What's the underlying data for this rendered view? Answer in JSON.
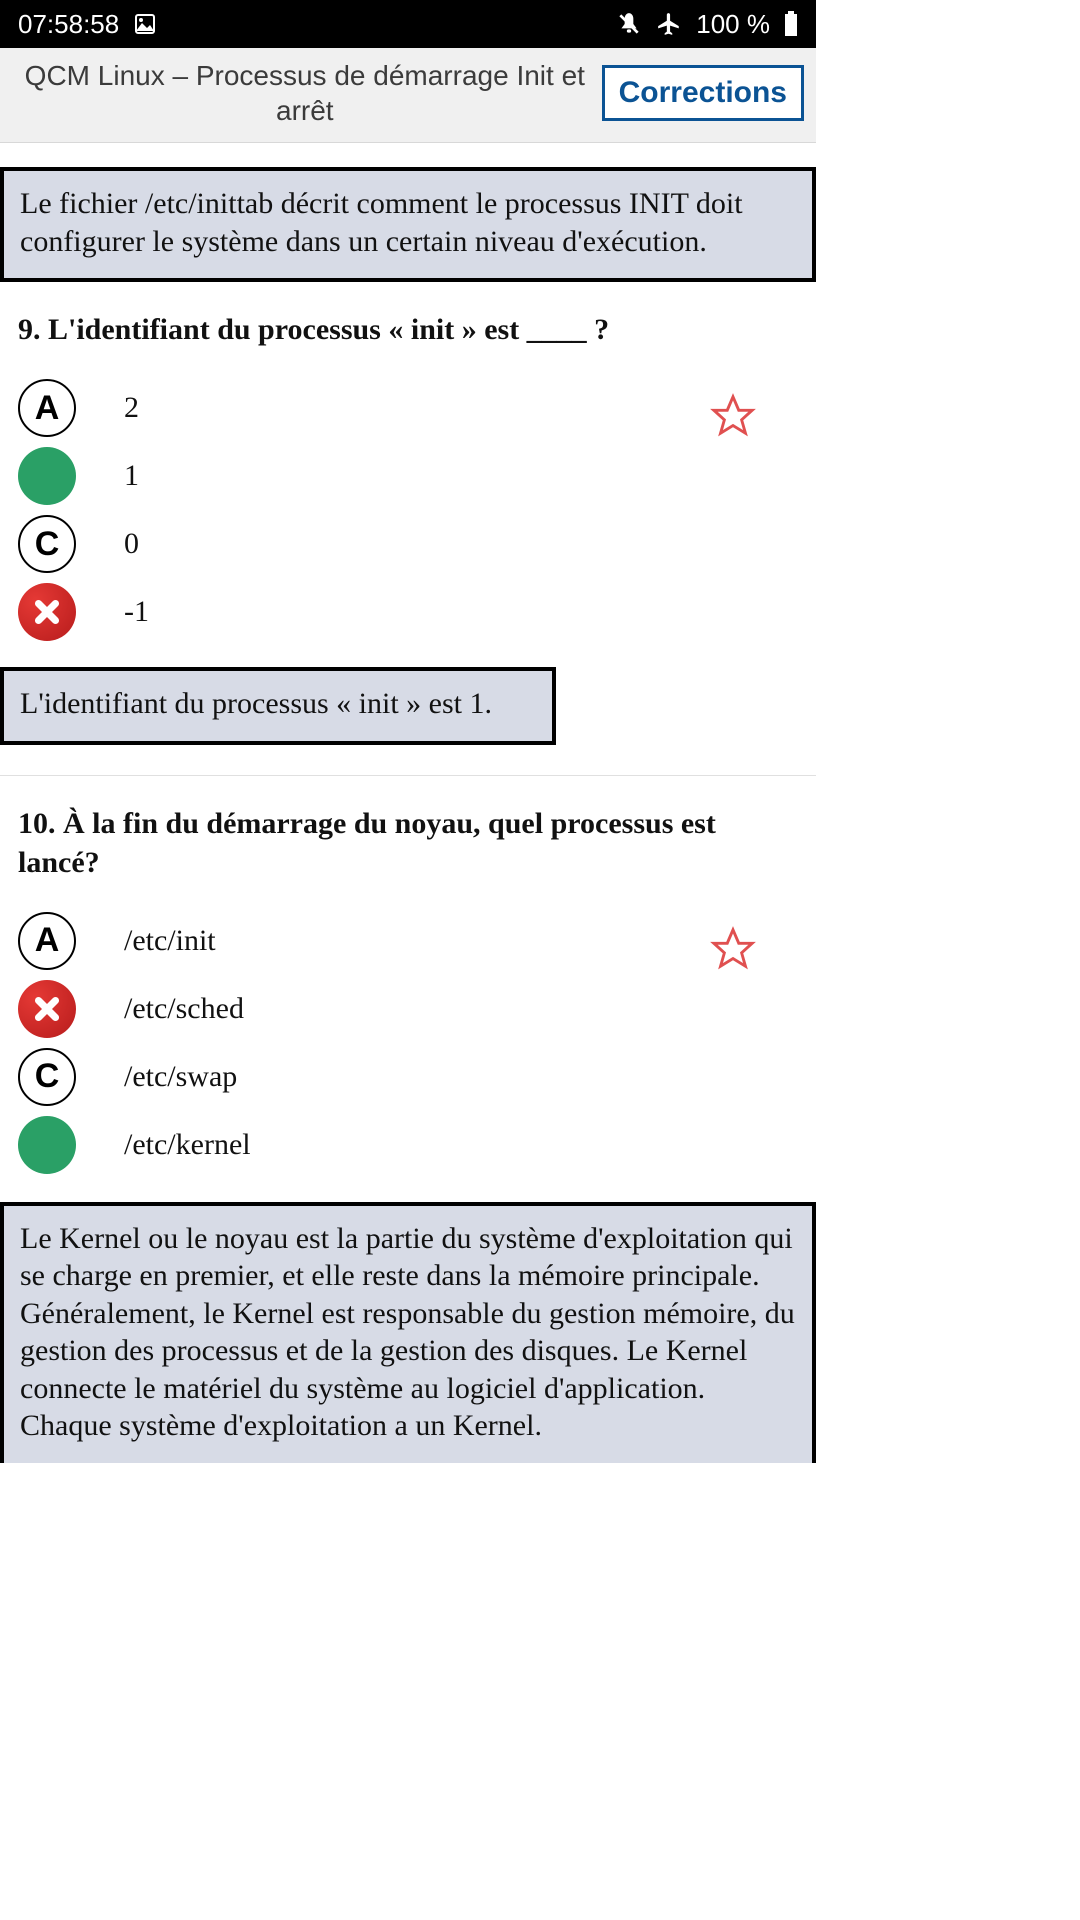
{
  "statusbar": {
    "time": "07:58:58",
    "battery_text": "100 %"
  },
  "appbar": {
    "title": "QCM Linux – Processus de démarrage Init et arrêt",
    "corrections_label": "Corrections"
  },
  "top_info": "Le fichier /etc/inittab décrit comment le processus INIT doit configurer le système dans un certain niveau d'exécution.",
  "q9": {
    "title": "9. L'identifiant du processus « init » est ____ ?",
    "options": [
      {
        "marker": "A",
        "state": "letter",
        "text": "2"
      },
      {
        "marker": "",
        "state": "correct",
        "text": "1"
      },
      {
        "marker": "C",
        "state": "letter",
        "text": "0"
      },
      {
        "marker": "",
        "state": "wrong",
        "text": "-1"
      }
    ],
    "explanation": "L'identifiant du processus « init » est 1."
  },
  "q10": {
    "title": "10. À la fin du démarrage du noyau, quel processus est lancé?",
    "options": [
      {
        "marker": "A",
        "state": "letter",
        "text": "/etc/init"
      },
      {
        "marker": "",
        "state": "wrong",
        "text": "/etc/sched"
      },
      {
        "marker": "C",
        "state": "letter",
        "text": "/etc/swap"
      },
      {
        "marker": "",
        "state": "correct",
        "text": "/etc/kernel"
      }
    ],
    "explanation": "Le Kernel ou le noyau est la partie du système d'exploitation qui se charge en premier, et elle reste dans la mémoire principale. Généralement, le Kernel est responsable du gestion mémoire, du gestion des processus et de la gestion des disques. Le Kernel connecte le matériel du système au logiciel d'application. Chaque système d'exploitation a un Kernel."
  }
}
